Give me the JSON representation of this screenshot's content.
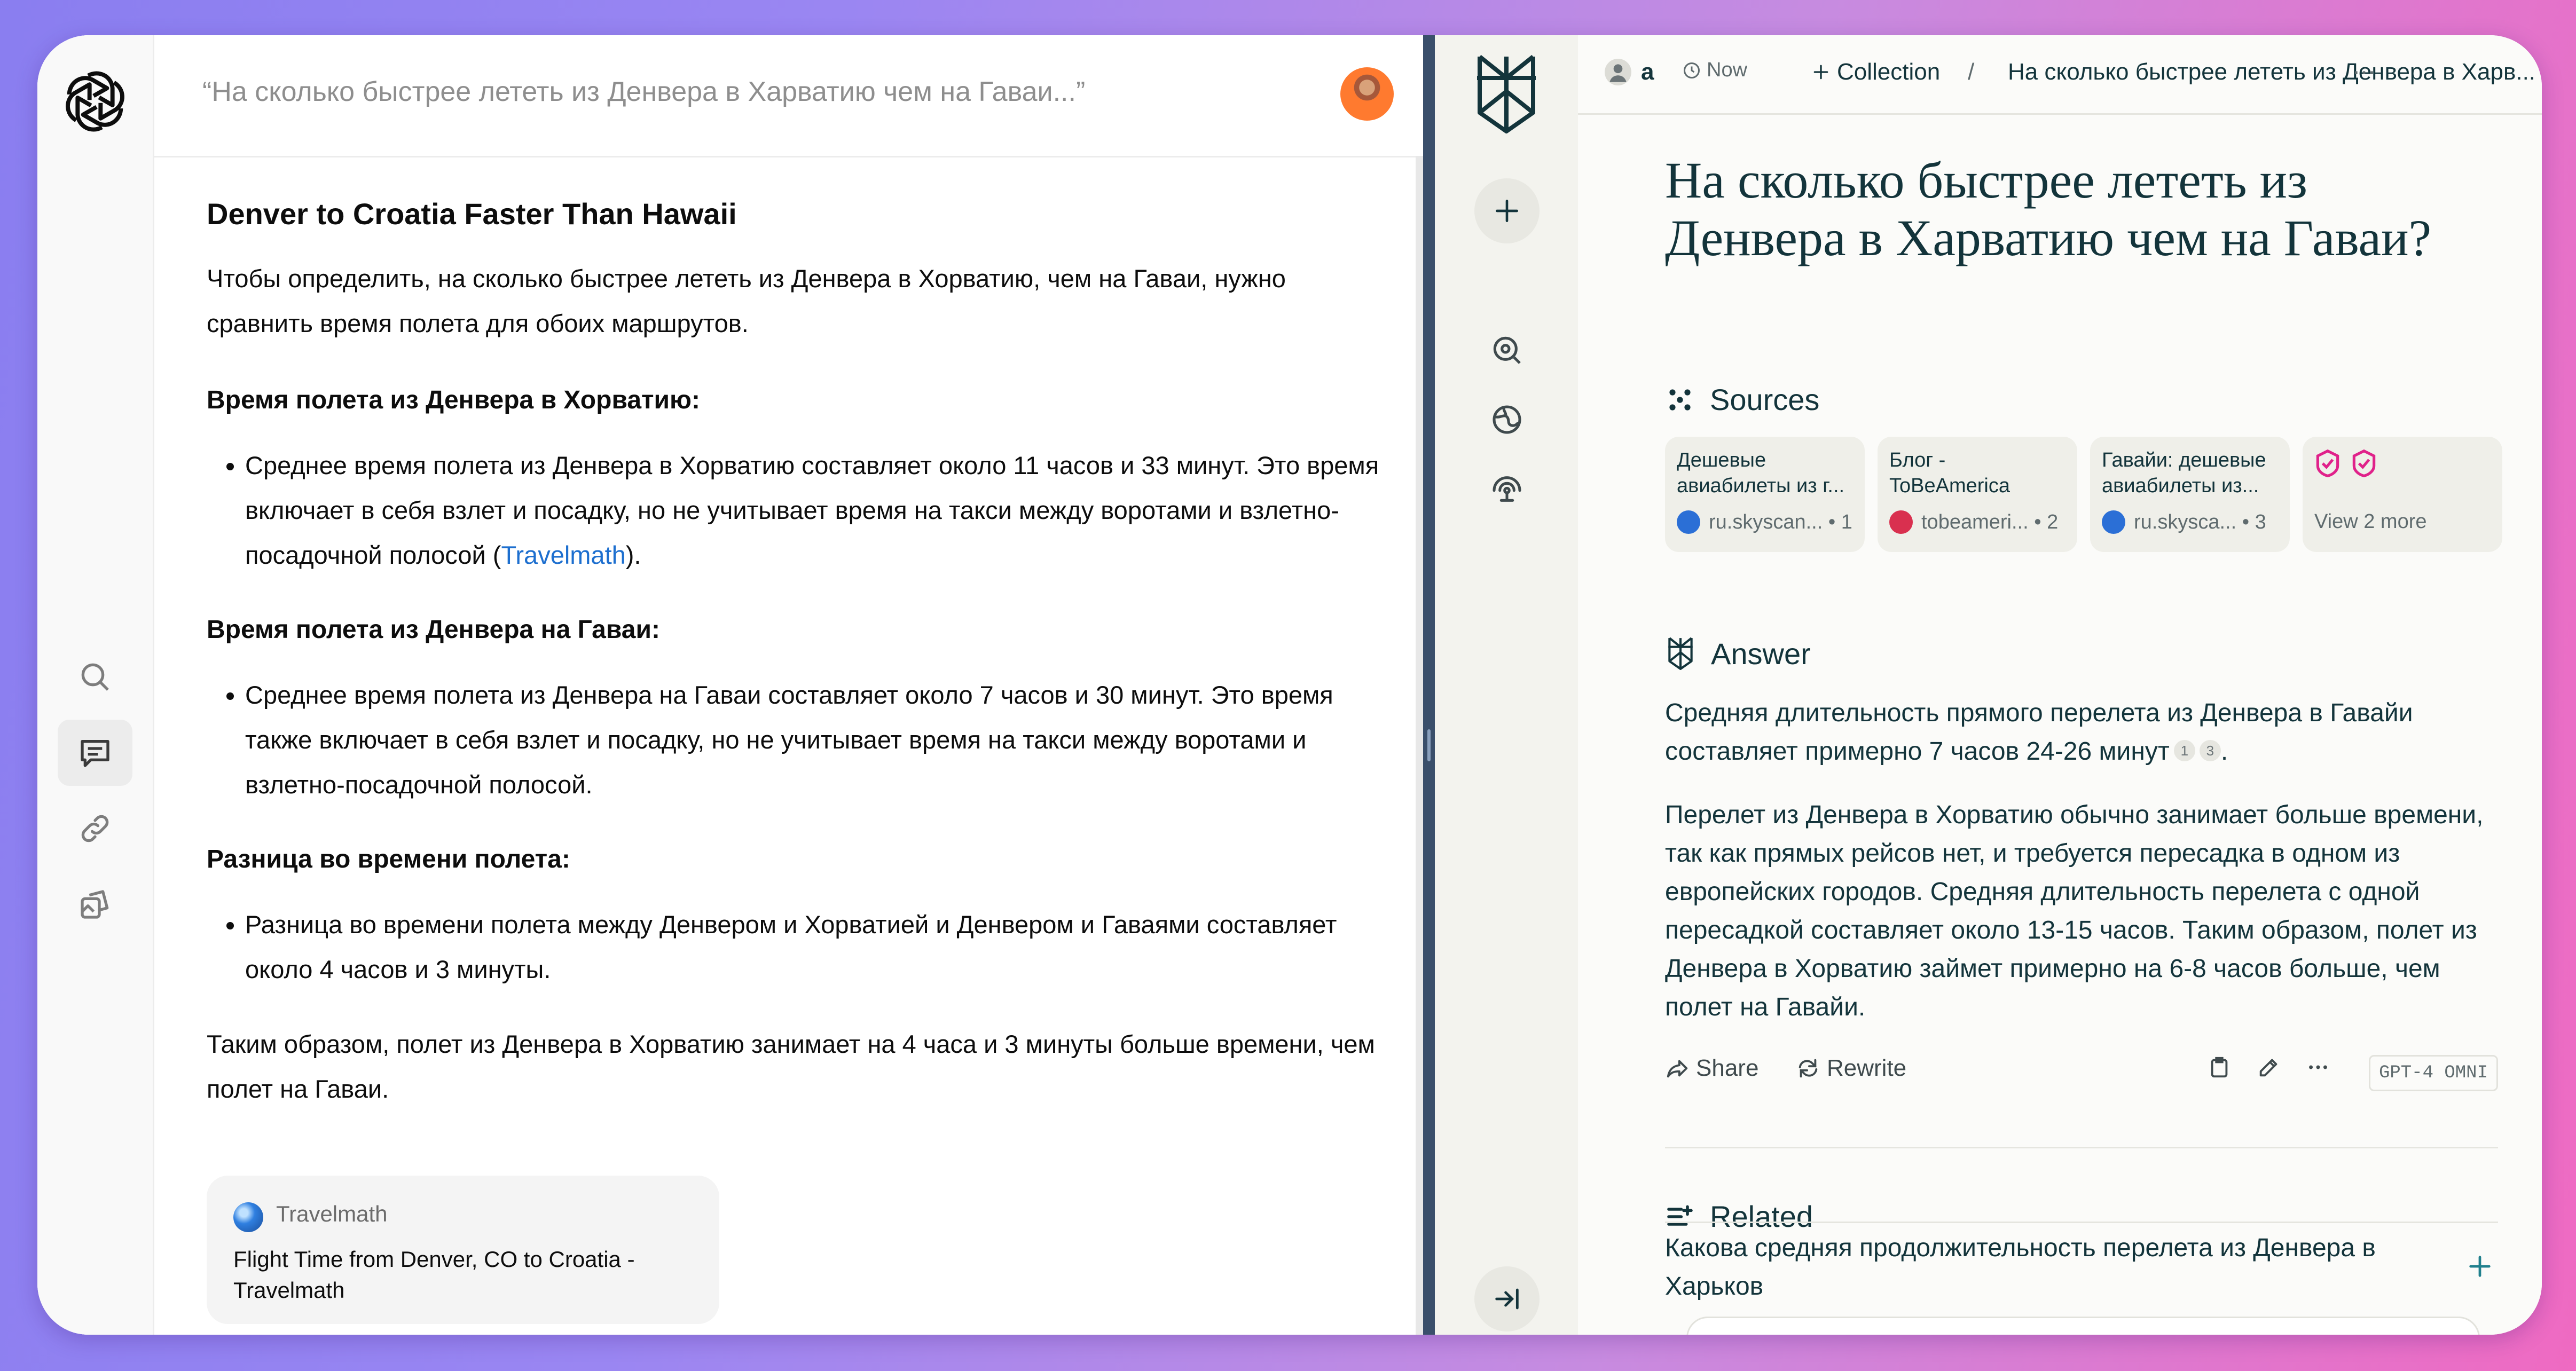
{
  "chatgpt": {
    "query": "“На сколько быстрее лететь из Денвера в Харватию чем на Гаваи...”",
    "title": "Denver to Croatia Faster Than Hawaii",
    "intro": "Чтобы определить, на сколько быстрее лететь из Денвера в Хорватию, чем на Гаваи, нужно сравнить время полета для обоих маршрутов.",
    "sections": [
      {
        "heading": "Время полета из Денвера в Хорватию:",
        "bullet": "Среднее время полета из Денвера в Хорватию составляет около 11 часов и 33 минут. Это время включает в себя взлет и посадку, но не учитывает время на такси между воротами и взлетно-посадочной полосой (",
        "citation": "Travelmath",
        "tail": ")."
      },
      {
        "heading": "Время полета из Денвера на Гаваи:",
        "bullet": "Среднее время полета из Денвера на Гаваи составляет около 7 часов и 30 минут. Это время также включает в себя взлет и посадку, но не учитывает время на такси между воротами и взлетно-посадочной полосой."
      },
      {
        "heading": "Разница во времени полета:",
        "bullet": "Разница во времени полета между Денвером и Хорватией и Денвером и Гаваями составляет около 4 часов и 3 минуты."
      }
    ],
    "conclusion": "Таким образом, полет из Денвера в Хорватию занимает на 4 часа и 3 минуты больше времени, чем полет на Гаваи.",
    "source_card": {
      "site": "Travelmath",
      "title": "Flight Time from Denver, CO to Croatia - Travelmath"
    }
  },
  "perplexity": {
    "topbar": {
      "user": "a",
      "time": "Now",
      "collection": "Collection",
      "separator": "/",
      "crumb": "На сколько быстрее лететь из Денвера в Харв...",
      "more": "⋯"
    },
    "title": "На сколько быстрее лететь из Денвера в Харватию чем на Гаваи?",
    "sources_heading": "Sources",
    "sources": [
      {
        "title": "Дешевые авиабилеты из г...",
        "site": "ru.skyscan...",
        "num": "1",
        "fav_color": "#2b6fd6"
      },
      {
        "title": "Блог - ToBeAmerica",
        "site": "tobeameri...",
        "num": "2",
        "fav_color": "#d9304f"
      },
      {
        "title": "Гавайи: дешевые авиабилеты из...",
        "site": "ru.skysca...",
        "num": "3",
        "fav_color": "#2b6fd6"
      }
    ],
    "view_more": "View 2 more",
    "answer_heading": "Answer",
    "answer_p1": "Средняя длительность прямого перелета из Денвера в Гавайи составляет примерно 7 часов 24-26 минут",
    "answer_p1_cites": [
      "1",
      "3"
    ],
    "answer_p1_end": ".",
    "answer_p2": "Перелет из Денвера в Хорватию обычно занимает больше времени, так как прямых рейсов нет, и требуется пересадка в одном из европейских городов. Средняя длительность перелета с одной пересадкой составляет около 13-15 часов. Таким образом, полет из Денвера в Хорватию займет примерно на 6-8 часов больше, чем полет на Гавайи.",
    "actions": {
      "share": "Share",
      "rewrite": "Rewrite",
      "model": "GPT-4 OMNI"
    },
    "related_heading": "Related",
    "related": [
      "Какова средняя продолжительность перелета из Денвера в Харьков"
    ]
  },
  "colors": {
    "perplexity_teal": "#13343b",
    "citation_blue": "#1d6fcf",
    "divider": "#3a4f6b"
  }
}
